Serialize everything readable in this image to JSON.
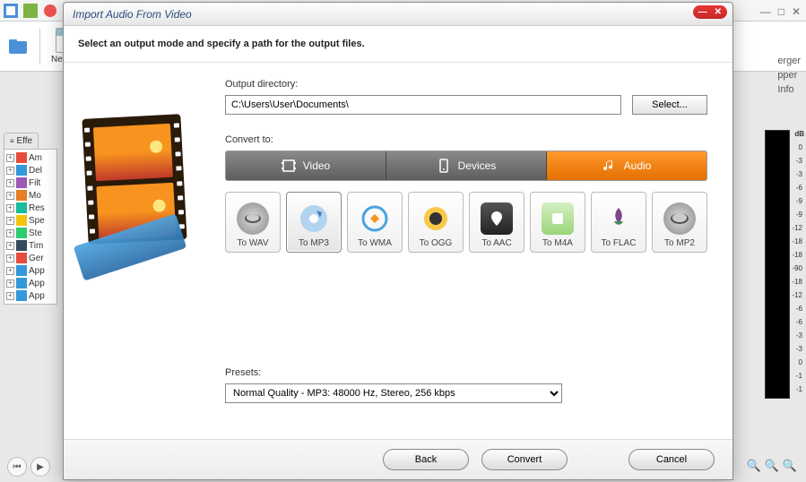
{
  "bg": {
    "newfile_label": "New File",
    "effects_tab": "Effe",
    "tree_items": [
      "Am",
      "Del",
      "Filt",
      "Mo",
      "Res",
      "Spe",
      "Ste",
      "Tim",
      "Ger",
      "App",
      "App",
      "App"
    ],
    "right_labels": [
      "erger",
      "pper",
      "Info"
    ],
    "db_label": "dB",
    "db_ticks": [
      "0",
      "-3",
      "-3",
      "-6",
      "-9",
      "-9",
      "-12",
      "-18",
      "-18",
      "-90",
      "-18",
      "-12",
      "-6",
      "-6",
      "-3",
      "-3",
      "0",
      "-1",
      "-1"
    ]
  },
  "modal": {
    "title": "Import Audio From Video",
    "instruction": "Select an output mode and specify a path for the output files.",
    "output_dir_label": "Output directory:",
    "output_dir_value": "C:\\Users\\User\\Documents\\",
    "select_btn": "Select...",
    "convert_to_label": "Convert to:",
    "tabs": {
      "video": "Video",
      "devices": "Devices",
      "audio": "Audio"
    },
    "formats": [
      {
        "label": "To WAV"
      },
      {
        "label": "To MP3"
      },
      {
        "label": "To WMA"
      },
      {
        "label": "To OGG"
      },
      {
        "label": "To AAC"
      },
      {
        "label": "To M4A"
      },
      {
        "label": "To FLAC"
      },
      {
        "label": "To MP2"
      }
    ],
    "presets_label": "Presets:",
    "presets_value": "Normal Quality - MP3: 48000 Hz, Stereo, 256 kbps",
    "footer": {
      "back": "Back",
      "convert": "Convert",
      "cancel": "Cancel"
    }
  }
}
